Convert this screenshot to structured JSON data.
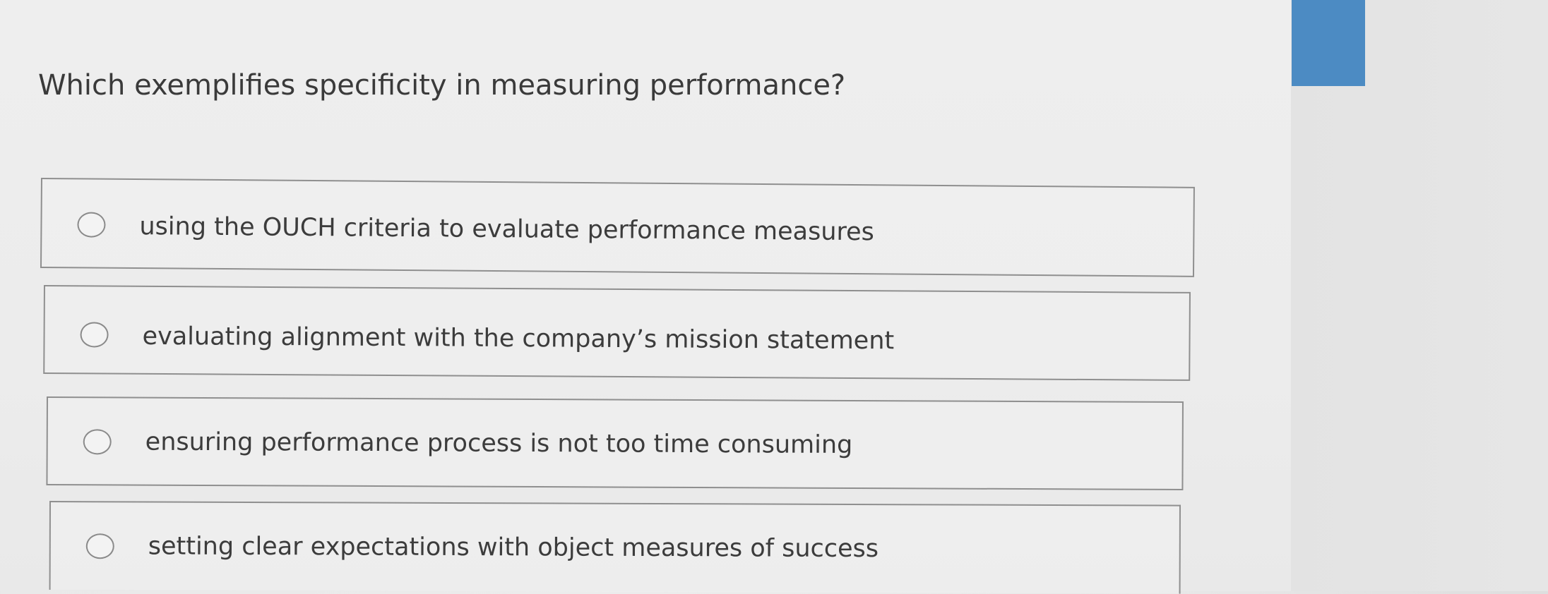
{
  "question": {
    "text": "Which exemplifies specificity in measuring performance?"
  },
  "options": [
    {
      "label": "using the OUCH criteria to evaluate performance measures"
    },
    {
      "label": "evaluating alignment with the company’s mission statement"
    },
    {
      "label": "ensuring performance process is not too time consuming"
    },
    {
      "label": "setting clear expectations with object measures of success"
    }
  ],
  "colors": {
    "accent": "#4c8bc3",
    "border": "#8f8f8f",
    "text": "#3c3c3c"
  }
}
